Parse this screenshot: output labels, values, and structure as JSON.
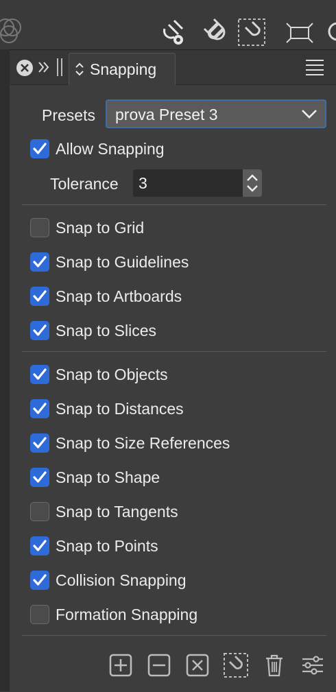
{
  "panel": {
    "tab_title": "Snapping",
    "presets_label": "Presets",
    "preset_value": "prova Preset 3",
    "allow_snapping": {
      "label": "Allow Snapping",
      "checked": true
    },
    "tolerance_label": "Tolerance",
    "tolerance_value": "3"
  },
  "options": [
    {
      "label": "Snap to Grid",
      "checked": false
    },
    {
      "label": "Snap to Guidelines",
      "checked": true
    },
    {
      "label": "Snap to Artboards",
      "checked": true
    },
    {
      "label": "Snap to Slices",
      "checked": true
    },
    {
      "label": "Snap to Objects",
      "checked": true
    },
    {
      "label": "Snap to Distances",
      "checked": true
    },
    {
      "label": "Snap to Size References",
      "checked": true
    },
    {
      "label": "Snap to Shape",
      "checked": true
    },
    {
      "label": "Snap to Tangents",
      "checked": false
    },
    {
      "label": "Snap to Points",
      "checked": true
    },
    {
      "label": "Collision Snapping",
      "checked": true
    },
    {
      "label": "Formation Snapping",
      "checked": false
    }
  ],
  "toolbar_icons": [
    "circles-icon",
    "snapping-settings-icon",
    "magnet-icon",
    "magnet-selection-icon",
    "resize-icon",
    "partial-icon"
  ],
  "bottom_icons": [
    "add-preset-icon",
    "remove-preset-icon",
    "reset-icon",
    "magnet-selection-icon",
    "trash-icon",
    "sliders-icon"
  ],
  "colors": {
    "accent": "#2f6ad9",
    "panel_bg": "#3d3d3d",
    "select_border": "#3f6ea6"
  }
}
